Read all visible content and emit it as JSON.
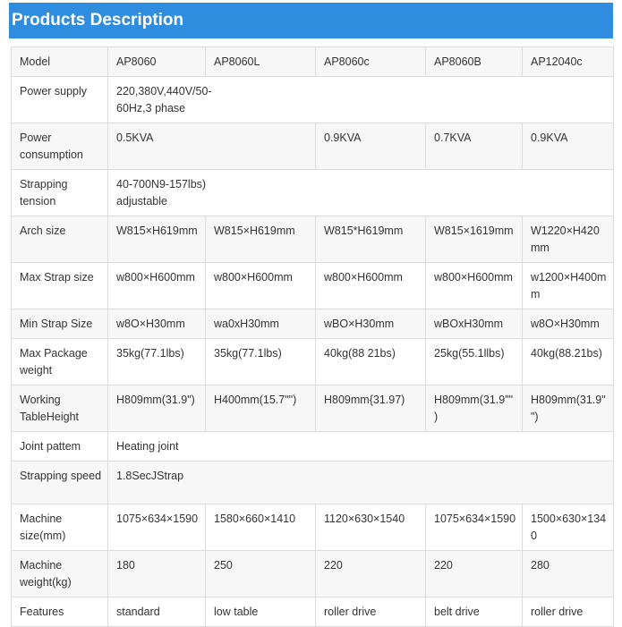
{
  "header": {
    "title": "Products Description"
  },
  "table": {
    "rows": [
      {
        "name": "model",
        "cells": [
          "Model",
          "AP8060",
          "AP8060L",
          "AP8060c",
          "AP8060B",
          "AP12040c"
        ]
      },
      {
        "name": "power-supply",
        "cells": [
          "Power supply",
          "220,380V,440V/50-60Hz,3 phase"
        ]
      },
      {
        "name": "power-consumption",
        "cells": [
          "Power consumption",
          "0.5KVA",
          "0.9KVA",
          "0.7KVA",
          "0.9KVA"
        ]
      },
      {
        "name": "strapping-tension",
        "cells": [
          "Strapping tension",
          "40-700N9-157lbs) adjustable"
        ]
      },
      {
        "name": "arch-size",
        "cells": [
          "Arch size",
          "W815×H619mm",
          "W815×H619mm",
          "W815*H619mm",
          "W815×1619mm",
          "W1220×H420mm"
        ]
      },
      {
        "name": "max-strap-size",
        "cells": [
          "Max Strap size",
          "w800×H600mm",
          "w800×H600mm",
          "w800×H600mm",
          "w800×H600mm",
          "w1200×H400mm"
        ]
      },
      {
        "name": "min-strap-size",
        "cells": [
          "Min Strap Size",
          "w8O×H30mm",
          "wa0xH30mm",
          "wBO×H30mm",
          "wBOxH30mm",
          "w8O×H30mm"
        ]
      },
      {
        "name": "max-package-weight",
        "cells": [
          "Max Package weight",
          "35kg(77.1lbs)",
          "35kg(77.1lbs)",
          "40kg(88 21bs)",
          "25kg(55.1llbs)",
          "40kg(88.21bs)"
        ]
      },
      {
        "name": "working-table-height",
        "cells": [
          "Working TableHeight",
          "H809mm(31.9\")",
          "H400mm(15.7\"\")",
          "H809mm{31.97)",
          "H809mm(31.9\"\")",
          "H809mm(31.9\"\")"
        ]
      },
      {
        "name": "joint-pattern",
        "cells": [
          "Joint pattem",
          "Heating joint"
        ]
      },
      {
        "name": "strapping-speed",
        "cells": [
          "Strapping speed",
          "1.8SecJStrap"
        ]
      },
      {
        "name": "machine-size",
        "cells": [
          "Machine size(mm)",
          "1075×634×1590",
          "1580×660×1410",
          "1120×630×1540",
          "1075×634×1590",
          "1500×630×1340"
        ]
      },
      {
        "name": "machine-weight",
        "cells": [
          "Machine weight(kg)",
          "180",
          "250",
          "220",
          "220",
          "280"
        ]
      },
      {
        "name": "features",
        "cells": [
          "Features",
          "standard",
          "low table",
          "roller drive",
          "belt drive",
          "roller drive"
        ]
      }
    ]
  }
}
